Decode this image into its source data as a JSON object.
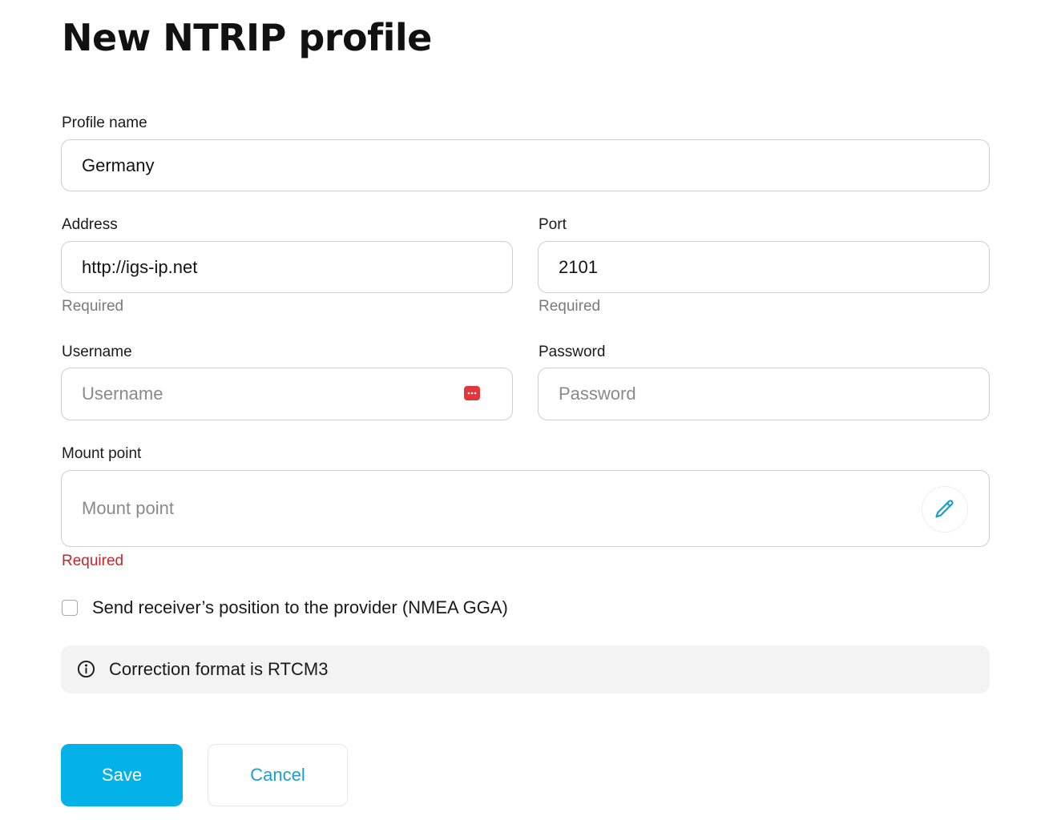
{
  "page": {
    "title": "New NTRIP profile"
  },
  "form": {
    "profile_name": {
      "label": "Profile name",
      "value": "Germany"
    },
    "address": {
      "label": "Address",
      "value": "http://igs-ip.net",
      "helper": "Required"
    },
    "port": {
      "label": "Port",
      "value": "2101",
      "helper": "Required"
    },
    "username": {
      "label": "Username",
      "placeholder": "Username"
    },
    "password": {
      "label": "Password",
      "placeholder": "Password"
    },
    "mount_point": {
      "label": "Mount point",
      "placeholder": "Mount point",
      "error": "Required"
    },
    "send_position": {
      "label": "Send receiver’s position to the provider (NMEA GGA)",
      "checked": false
    }
  },
  "info": {
    "icon": "info-icon",
    "text": "Correction format is RTCM3"
  },
  "buttons": {
    "save": "Save",
    "cancel": "Cancel"
  },
  "colors": {
    "accent": "#04b2ea",
    "link": "#1c9fcc",
    "error": "#c6252b",
    "password_manager_icon": "#e0363c"
  }
}
